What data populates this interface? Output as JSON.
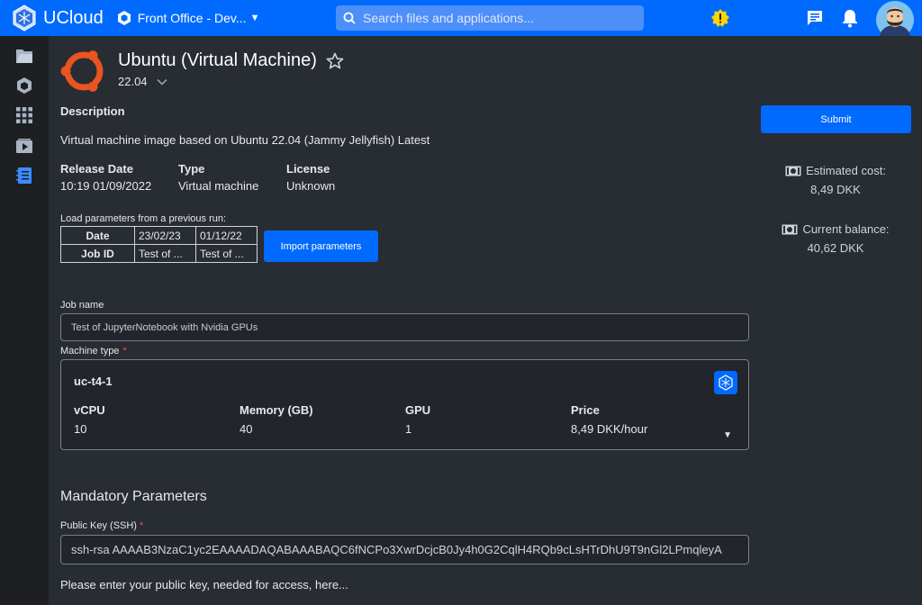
{
  "header": {
    "brand": "UCloud",
    "project": "Front Office - Dev...",
    "search_placeholder": "Search files and applications...",
    "icons": [
      "ucloud-logo-icon",
      "project-hex-icon",
      "search-icon",
      "notification-badge-icon",
      "chat-icon",
      "bell-icon",
      "avatar"
    ]
  },
  "sidebar": {
    "items": [
      {
        "name": "files",
        "icon": "folder-icon"
      },
      {
        "name": "projects",
        "icon": "hexagon-icon"
      },
      {
        "name": "apps",
        "icon": "grid-icon"
      },
      {
        "name": "runs",
        "icon": "play-icon"
      },
      {
        "name": "resources",
        "icon": "notebook-icon"
      }
    ]
  },
  "app": {
    "title": "Ubuntu (Virtual Machine)",
    "version": "22.04",
    "description_heading": "Description",
    "description": "Virtual machine image based on Ubuntu 22.04 (Jammy Jellyfish) Latest",
    "release_label": "Release Date",
    "release_value": "10:19 01/09/2022",
    "type_label": "Type",
    "type_value": "Virtual machine",
    "license_label": "License",
    "license_value": "Unknown"
  },
  "previous_runs": {
    "label": "Load parameters from a previous run:",
    "row_headers": [
      "Date",
      "Job ID"
    ],
    "columns": [
      {
        "date": "23/02/23",
        "job_id": "Test of ..."
      },
      {
        "date": "01/12/22",
        "job_id": "Test of ..."
      }
    ],
    "import_button": "Import parameters"
  },
  "job": {
    "name_label": "Job name",
    "name_value": "Test of JupyterNotebook with Nvidia GPUs",
    "machine_label": "Machine type",
    "required_mark": "*"
  },
  "machine": {
    "name": "uc-t4-1",
    "columns": [
      {
        "header": "vCPU",
        "value": "10"
      },
      {
        "header": "Memory (GB)",
        "value": "40"
      },
      {
        "header": "GPU",
        "value": "1"
      },
      {
        "header": "Price",
        "value": "8,49 DKK/hour"
      }
    ]
  },
  "mandatory": {
    "heading": "Mandatory Parameters",
    "ssh_label": "Public Key (SSH)",
    "ssh_value": "ssh-rsa AAAAB3NzaC1yc2EAAAADAQABAAABAQC6fNCPo3XwrDcjcB0Jy4h0G2CqlH4RQb9cLsHTrDhU9T9nGl2LPmqleyA",
    "help": "Please enter your public key, needed for access, here..."
  },
  "side_panel": {
    "submit": "Submit",
    "cost_label": "Estimated cost:",
    "cost_value": "8,49 DKK",
    "balance_label": "Current balance:",
    "balance_value": "40,62 DKK"
  },
  "colors": {
    "accent": "#006aff",
    "background": "#282c33",
    "sidebar": "#1d1f23",
    "required": "#ff4d4d"
  }
}
